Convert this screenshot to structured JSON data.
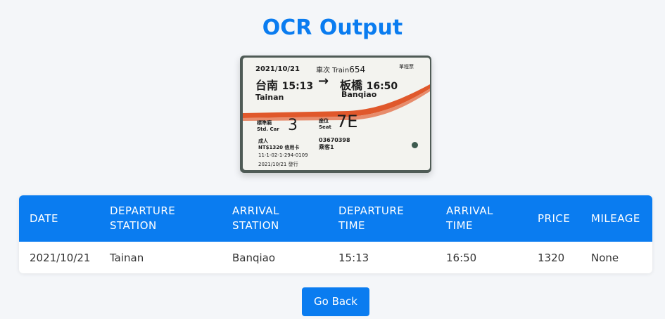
{
  "page": {
    "title": "OCR Output"
  },
  "ticket": {
    "date": "2021/10/21",
    "train_label": "車次 Train",
    "train_no": "654",
    "ticket_type": "單程票",
    "from_zh": "台南",
    "depart_time": "15:13",
    "arrow": "→",
    "to_zh": "板橋",
    "arrive_time": "16:50",
    "from_en": "Tainan",
    "to_en": "Banqiao",
    "car_label_zh": "標準廂",
    "car_label_en": "Std. Car",
    "car_no": "3",
    "seat_label_zh": "座位",
    "seat_label_en": "Seat",
    "seat_no": "7E",
    "passenger": "成人",
    "fare": "NT$1320 信用卡",
    "serial": "03670398",
    "serial_note": "乘客1",
    "code": "11-1-02-1-294-0109",
    "issued": "2021/10/21 發行",
    "colors": {
      "stripe_orange": "#e0582b",
      "stripe_red": "#c93a1c"
    }
  },
  "table": {
    "headers": {
      "date": "DATE",
      "dep_station_1": "DEPARTURE",
      "dep_station_2": "STATION",
      "arr_station_1": "ARRIVAL",
      "arr_station_2": "STATION",
      "dep_time_1": "DEPARTURE",
      "dep_time_2": "TIME",
      "arr_time_1": "ARRIVAL",
      "arr_time_2": "TIME",
      "price": "PRICE",
      "mileage": "MILEAGE"
    },
    "row": {
      "date": "2021/10/21",
      "departure_station": "Tainan",
      "arrival_station": "Banqiao",
      "departure_time": "15:13",
      "arrival_time": "16:50",
      "price": "1320",
      "mileage": "None"
    }
  },
  "actions": {
    "go_back": "Go Back"
  },
  "colors": {
    "accent": "#0a7cf0",
    "background": "#f4f6f9"
  }
}
